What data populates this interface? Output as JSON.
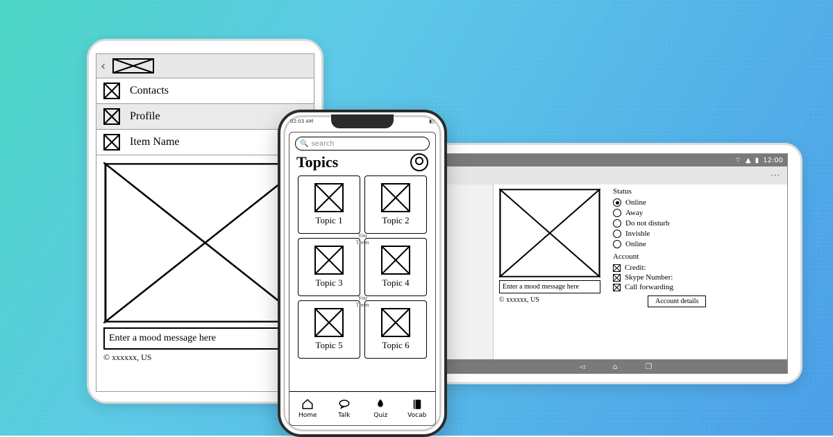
{
  "tablet_portrait": {
    "menu": [
      {
        "label": "Contacts"
      },
      {
        "label": "Profile",
        "selected": true
      },
      {
        "label": "Item Name"
      }
    ],
    "mood_placeholder": "Enter a mood message here",
    "location": "© xxxxxx, US"
  },
  "phone": {
    "status_time": "02:03 AM",
    "search_placeholder": "search",
    "title": "Topics",
    "topics": [
      {
        "label": "Topic 1"
      },
      {
        "label": "Topic 2"
      },
      {
        "label": "Topic 3"
      },
      {
        "label": "Topic 4"
      },
      {
        "label": "Topic 5"
      },
      {
        "label": "Topic 6"
      }
    ],
    "chat_labels": {
      "you": "You",
      "them": "Them"
    },
    "nav": [
      {
        "label": "Home"
      },
      {
        "label": "Talk"
      },
      {
        "label": "Quiz"
      },
      {
        "label": "Vocab"
      }
    ]
  },
  "tablet_landscape": {
    "status_time": "12:00",
    "mood_placeholder": "Enter a mood message here",
    "location": "© xxxxxx, US",
    "status_section": {
      "title": "Status",
      "options": [
        {
          "label": "Online",
          "selected": true
        },
        {
          "label": "Away"
        },
        {
          "label": "Do not disturb"
        },
        {
          "label": "Invisble"
        },
        {
          "label": "Online"
        }
      ]
    },
    "account_section": {
      "title": "Account",
      "items": [
        {
          "label": "Credit:"
        },
        {
          "label": "Skype Number:"
        },
        {
          "label": "Call forwarding"
        }
      ],
      "button": "Account details"
    }
  }
}
